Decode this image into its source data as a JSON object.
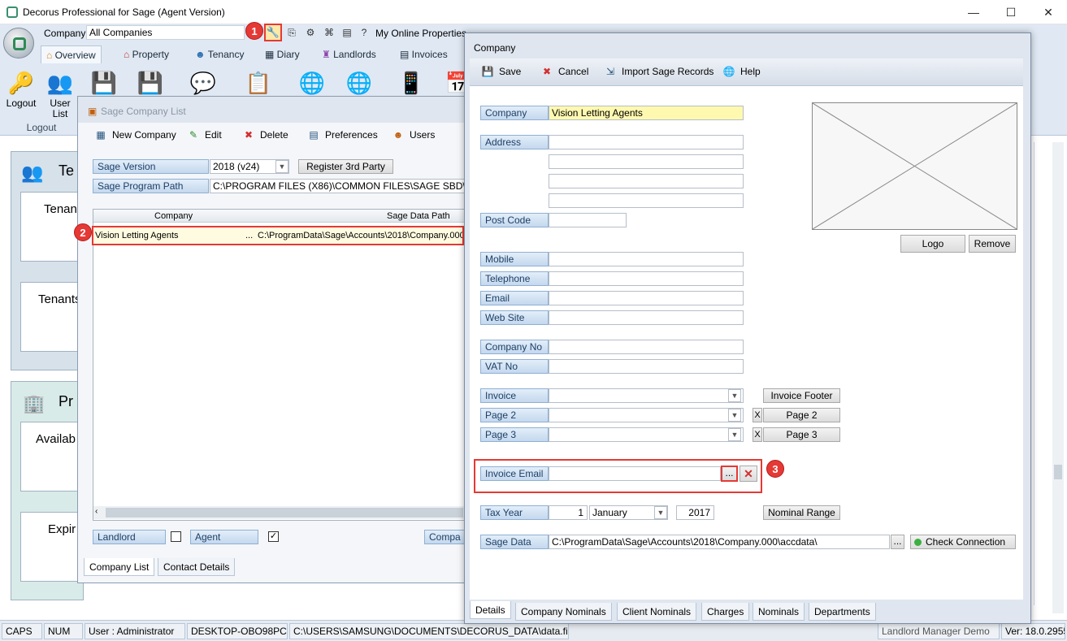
{
  "window": {
    "title": "Decorus Professional  for Sage (Agent Version)",
    "minimize": "—",
    "maximize": "☐",
    "close": "✕"
  },
  "qat": {
    "company_label": "Company",
    "company_value": "All Companies",
    "online_properties": "My Online Properties"
  },
  "tabs": [
    "Overview",
    "Property",
    "Tenancy",
    "Diary",
    "Landlords",
    "Invoices"
  ],
  "ribbon": {
    "logout": "Logout",
    "user_list_1": "User",
    "user_list_2": "List",
    "group_logout": "Logout"
  },
  "background": {
    "panel1_title": "Te",
    "card1": "Tenan",
    "card2": "Tenants",
    "panel2_title": "Pr",
    "card3": "Availab",
    "card4": "Expir"
  },
  "sage_list": {
    "title": "Sage Company List",
    "toolbar": [
      "New Company",
      "Edit",
      "Delete",
      "Preferences",
      "Users"
    ],
    "sage_version_label": "Sage Version",
    "sage_version_value": "2018 (v24)",
    "register_btn": "Register 3rd Party",
    "program_path_label": "Sage Program Path",
    "program_path_value": "C:\\PROGRAM FILES (X86)\\COMMON FILES\\SAGE SBD\\S",
    "col_company": "Company",
    "col_path": "Sage Data Path",
    "row_company": "Vision Letting Agents",
    "row_ellipsis": "...",
    "row_path": "C:\\ProgramData\\Sage\\Accounts\\2018\\Company.000",
    "landlord_label": "Landlord",
    "agent_label": "Agent",
    "agent_checked": "✓",
    "company_btn": "Compa",
    "tab_company_list": "Company List",
    "tab_contact": "Contact Details"
  },
  "company": {
    "title": "Company",
    "toolbar": {
      "save": "Save",
      "cancel": "Cancel",
      "import": "Import Sage Records",
      "help": "Help"
    },
    "labels": {
      "company": "Company",
      "address": "Address",
      "post_code": "Post Code",
      "mobile": "Mobile",
      "telephone": "Telephone",
      "email": "Email",
      "web_site": "Web Site",
      "company_no": "Company No",
      "vat_no": "VAT No",
      "invoice": "Invoice",
      "page2": "Page 2",
      "page3": "Page 3",
      "invoice_email": "Invoice Email",
      "tax_year": "Tax Year",
      "sage_data": "Sage Data"
    },
    "company_value": "Vision Letting Agents",
    "logo_btn": "Logo",
    "remove_btn": "Remove",
    "invoice_footer_btn": "Invoice Footer",
    "page2_btn": "Page 2",
    "page3_btn": "Page 3",
    "x_mark": "X",
    "ellipsis": "...",
    "tax_day": "1",
    "tax_month": "January",
    "tax_year": "2017",
    "nominal_range_btn": "Nominal Range",
    "sage_data_value": "C:\\ProgramData\\Sage\\Accounts\\2018\\Company.000\\accdata\\",
    "check_connection": "Check Connection",
    "bottom_tabs": [
      "Details",
      "Company Nominals",
      "Client Nominals",
      "Charges",
      "Nominals",
      "Departments"
    ]
  },
  "badges": [
    "1",
    "2",
    "3"
  ],
  "status": {
    "caps": "CAPS",
    "num": "NUM",
    "user": "User : Administrator",
    "machine": "DESKTOP-OBO98PC",
    "path": "C:\\USERS\\SAMSUNG\\DOCUMENTS\\DECORUS_DATA\\data.fi",
    "version": "Ver: 18.0.2955",
    "product": "Landlord Manager Demo"
  },
  "colors": {
    "highlight": "#e53935",
    "label_blue": "#1d3f66",
    "yellow_field": "#fff9b0"
  }
}
